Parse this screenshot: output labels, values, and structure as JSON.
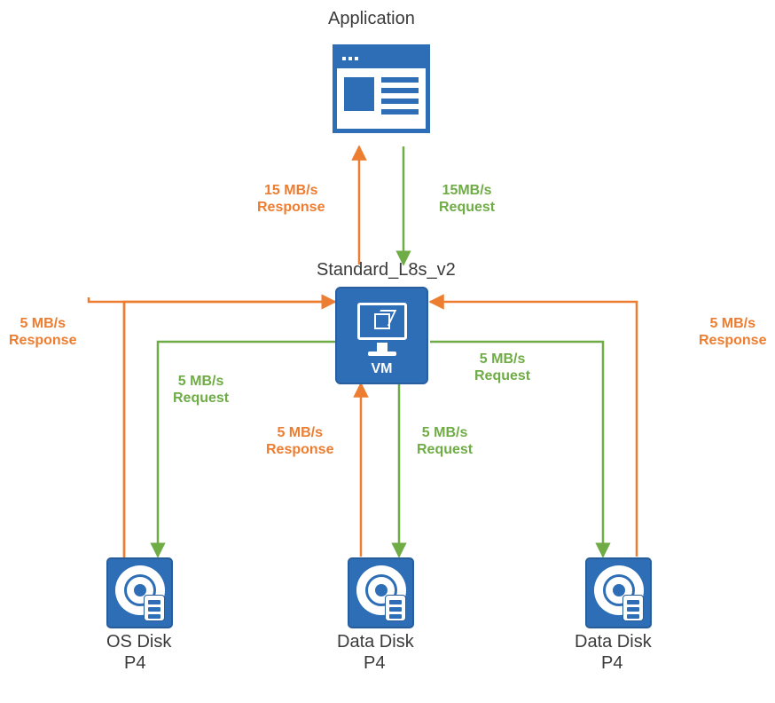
{
  "title": "Application",
  "vm": {
    "label_top": "Standard_L8s_v2",
    "label_inside": "VM"
  },
  "disks": [
    {
      "name": "OS Disk",
      "tier": "P4"
    },
    {
      "name": "Data Disk",
      "tier": "P4"
    },
    {
      "name": "Data Disk",
      "tier": "P4"
    }
  ],
  "edges": {
    "app_response": "15 MB/s\nResponse",
    "app_request": "15MB/s\nRequest",
    "left_response": "5 MB/s\nResponse",
    "left_request": "5 MB/s\nRequest",
    "mid_response": "5 MB/s\nResponse",
    "mid_request": "5 MB/s\nRequest",
    "right_response": "5 MB/s\nResponse",
    "right_request": "5 MB/s\nRequest"
  },
  "colors": {
    "node": "#2e6eb6",
    "request": "#6fac46",
    "response": "#ec7d31"
  }
}
